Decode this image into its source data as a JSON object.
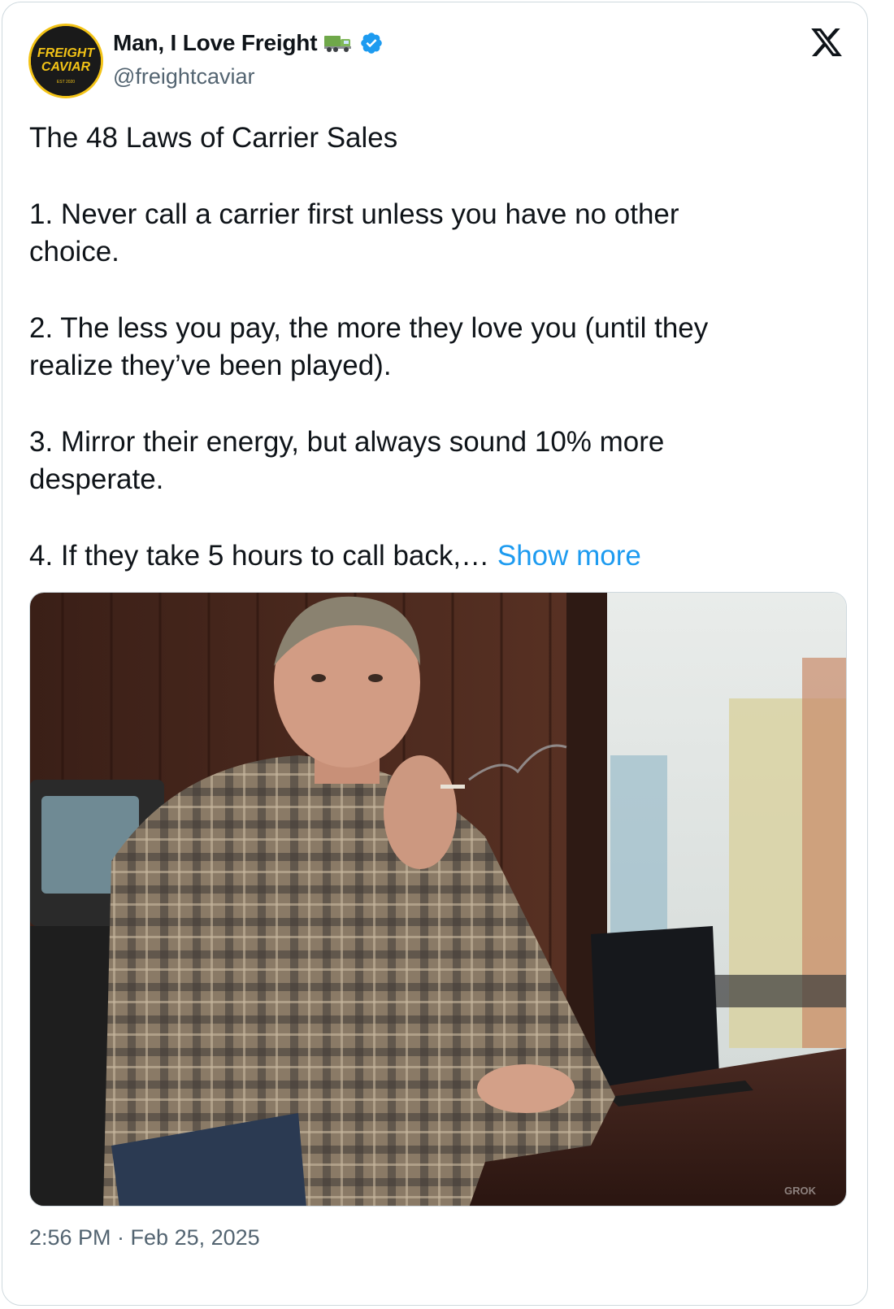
{
  "author": {
    "display_name": "Man, I Love Freight",
    "handle": "@freightcaviar",
    "verified": true,
    "avatar_text_line1": "FREIGHT",
    "avatar_text_line2": "CAVIAR",
    "avatar_text_line3": "EST 2020"
  },
  "tweet": {
    "title_line": "The 48 Laws of Carrier Sales",
    "laws": [
      {
        "lines": [
          "1. Never call a carrier first unless you have no other",
          "choice."
        ]
      },
      {
        "lines": [
          "2. The less you pay, the more they love you (until they",
          "realize they’ve been played)."
        ]
      },
      {
        "lines": [
          "3. Mirror their energy, but always sound 10% more",
          "desperate."
        ]
      }
    ],
    "truncated_line": "4. If they take 5 hours to call back,… ",
    "show_more_label": "Show more"
  },
  "media": {
    "watermark": "GROK"
  },
  "timestamp": "2:56 PM · Feb 25, 2025",
  "colors": {
    "link": "#1d9bf0",
    "secondary_text": "#536471",
    "verified": "#1d9bf0",
    "border": "#cfd9de",
    "avatar_ring": "#f3c316"
  },
  "icons": [
    "truck-emoji-icon",
    "verified-badge-icon",
    "x-logo-icon"
  ]
}
